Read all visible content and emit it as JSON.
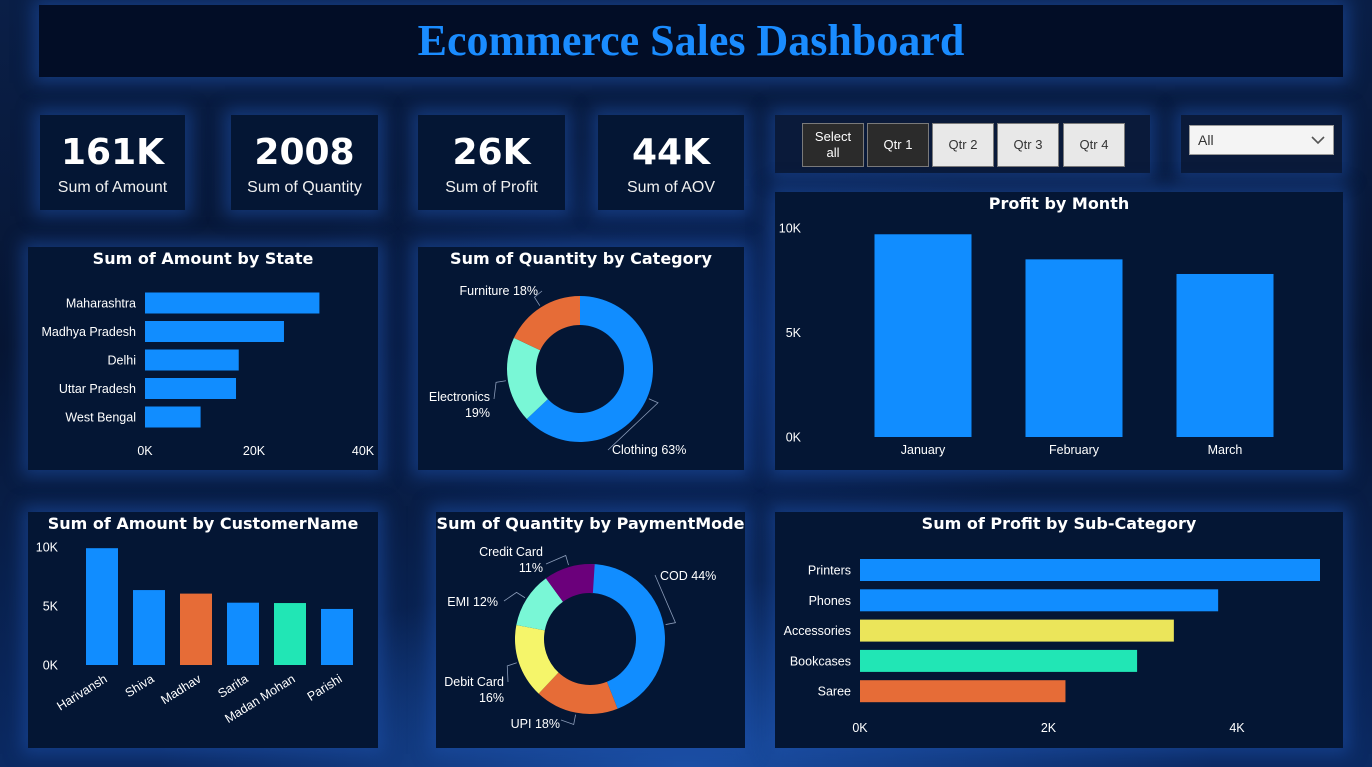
{
  "title": "Ecommerce Sales Dashboard",
  "kpis": [
    {
      "value": "161K",
      "label": "Sum of Amount"
    },
    {
      "value": "2008",
      "label": "Sum of Quantity"
    },
    {
      "value": "26K",
      "label": "Sum of Profit"
    },
    {
      "value": "44K",
      "label": "Sum of AOV"
    }
  ],
  "slicer": {
    "buttons": [
      {
        "label": "Select\nall",
        "selected": true
      },
      {
        "label": "Qtr 1",
        "selected": true
      },
      {
        "label": "Qtr 2",
        "selected": false
      },
      {
        "label": "Qtr 3",
        "selected": false
      },
      {
        "label": "Qtr 4",
        "selected": false
      }
    ],
    "dropdown_value": "All"
  },
  "colors": {
    "blue": "#118dff",
    "orange": "#e66c37",
    "teal": "#21e6b5",
    "yellow": "#ebe55a",
    "purple": "#6b007b",
    "mint": "#79f7d6",
    "lightyellow": "#f5f56a"
  },
  "chart_data": [
    {
      "id": "amount_by_state",
      "type": "bar",
      "orientation": "horizontal",
      "title": "Sum of Amount by State",
      "categories": [
        "Maharashtra",
        "Madhya Pradesh",
        "Delhi",
        "Uttar Pradesh",
        "West Bengal"
      ],
      "values": [
        32000,
        25500,
        17200,
        16700,
        10200
      ],
      "xlim": [
        0,
        40000
      ],
      "ticks": [
        {
          "v": 0,
          "label": "0K"
        },
        {
          "v": 20000,
          "label": "20K"
        },
        {
          "v": 40000,
          "label": "40K"
        }
      ],
      "colors": [
        "#118dff",
        "#118dff",
        "#118dff",
        "#118dff",
        "#118dff"
      ]
    },
    {
      "id": "quantity_by_category",
      "type": "pie",
      "donut": true,
      "title": "Sum of Quantity by Category",
      "slices": [
        {
          "name": "Clothing",
          "pct": 63,
          "label": "Clothing 63%",
          "color": "#118dff"
        },
        {
          "name": "Electronics",
          "pct": 19,
          "label": "Electronics\n19%",
          "color": "#79f7d6"
        },
        {
          "name": "Furniture",
          "pct": 18,
          "label": "Furniture 18%",
          "color": "#e66c37"
        }
      ]
    },
    {
      "id": "profit_by_month",
      "type": "bar",
      "orientation": "vertical",
      "title": "Profit by Month",
      "categories": [
        "January",
        "February",
        "March"
      ],
      "values": [
        9700,
        8500,
        7800
      ],
      "ylim": [
        0,
        10000
      ],
      "ticks": [
        {
          "v": 0,
          "label": "0K"
        },
        {
          "v": 5000,
          "label": "5K"
        },
        {
          "v": 10000,
          "label": "10K"
        }
      ],
      "colors": [
        "#118dff",
        "#118dff",
        "#118dff"
      ]
    },
    {
      "id": "amount_by_customer",
      "type": "bar",
      "orientation": "vertical",
      "title": "Sum of Amount by CustomerName",
      "categories": [
        "Harivansh",
        "Shiva",
        "Madhav",
        "Sarita",
        "Madan Mohan",
        "Parishi"
      ],
      "values": [
        9900,
        6350,
        6050,
        5280,
        5250,
        4750
      ],
      "ylim": [
        0,
        10000
      ],
      "ticks": [
        {
          "v": 0,
          "label": "0K"
        },
        {
          "v": 5000,
          "label": "5K"
        },
        {
          "v": 10000,
          "label": "10K"
        }
      ],
      "colors": [
        "#118dff",
        "#118dff",
        "#e66c37",
        "#118dff",
        "#21e6b5",
        "#118dff"
      ]
    },
    {
      "id": "quantity_by_payment",
      "type": "pie",
      "donut": true,
      "title": "Sum of Quantity by PaymentMode",
      "slices": [
        {
          "name": "COD",
          "pct": 44,
          "label": "COD 44%",
          "color": "#118dff"
        },
        {
          "name": "UPI",
          "pct": 18,
          "label": "UPI 18%",
          "color": "#e66c37"
        },
        {
          "name": "Debit Card",
          "pct": 16,
          "label": "Debit Card\n16%",
          "color": "#f5f56a"
        },
        {
          "name": "EMI",
          "pct": 12,
          "label": "EMI 12%",
          "color": "#79f7d6"
        },
        {
          "name": "Credit Card",
          "pct": 11,
          "label": "Credit Card\n11%",
          "color": "#6b007b"
        }
      ]
    },
    {
      "id": "profit_by_subcategory",
      "type": "bar",
      "orientation": "horizontal",
      "title": "Sum of Profit by Sub-Category",
      "categories": [
        "Printers",
        "Phones",
        "Accessories",
        "Bookcases",
        "Saree"
      ],
      "values": [
        4900,
        3800,
        3330,
        2940,
        2180
      ],
      "xlim": [
        0,
        4000
      ],
      "ticks": [
        {
          "v": 0,
          "label": "0K"
        },
        {
          "v": 2000,
          "label": "2K"
        },
        {
          "v": 4000,
          "label": "4K"
        }
      ],
      "colors": [
        "#118dff",
        "#118dff",
        "#ebe55a",
        "#21e6b5",
        "#e66c37"
      ]
    }
  ]
}
